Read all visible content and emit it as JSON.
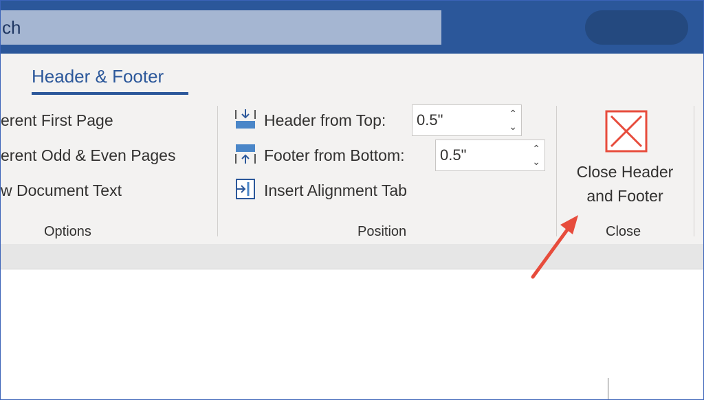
{
  "title_bar": {
    "search_text": "ch"
  },
  "ribbon": {
    "active_tab": "Header & Footer",
    "options": {
      "items": [
        "erent First Page",
        "erent Odd & Even Pages",
        "w Document Text"
      ],
      "group_label": "Options"
    },
    "position": {
      "header_from_top": {
        "label": "Header from Top:",
        "value": "0.5\""
      },
      "footer_from_bottom": {
        "label": "Footer from Bottom:",
        "value": "0.5\""
      },
      "insert_alignment_tab": "Insert Alignment Tab",
      "group_label": "Position"
    },
    "close": {
      "button_line1": "Close Header",
      "button_line2": "and Footer",
      "group_label": "Close"
    }
  },
  "colors": {
    "title_bar": "#2b579a",
    "accent": "#2b579a",
    "close_icon": "#e74c3c",
    "arrow": "#e74c3c"
  },
  "icons": [
    "header-from-top-icon",
    "footer-from-bottom-icon",
    "insert-alignment-tab-icon",
    "close-x-icon",
    "annotation-arrow"
  ]
}
